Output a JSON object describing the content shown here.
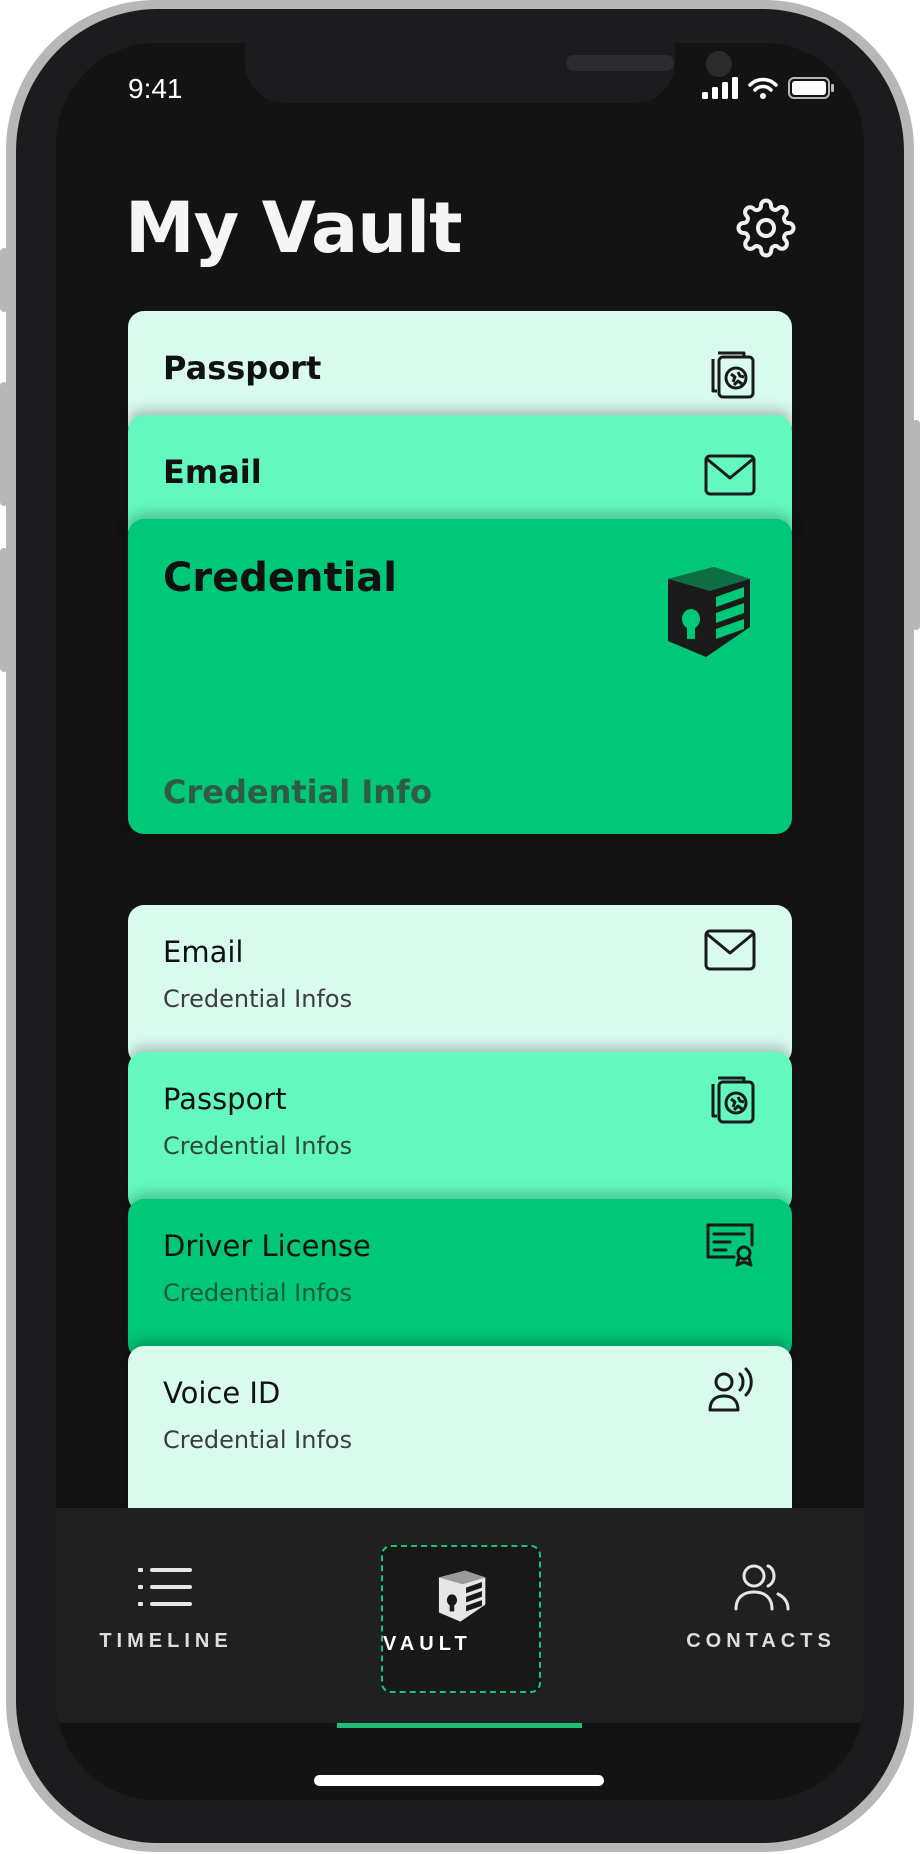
{
  "status_bar": {
    "time": "9:41"
  },
  "header": {
    "title": "My Vault"
  },
  "stack_top": {
    "cards": [
      {
        "title": "Passport",
        "icon": "passport-icon",
        "color": "#d9fbee"
      },
      {
        "title": "Email",
        "icon": "mail-icon",
        "color": "#63f8be"
      },
      {
        "title": "Credential",
        "subtitle": "Credential Info",
        "icon": "vault-box-icon",
        "color": "#00c878"
      }
    ]
  },
  "stack_list": {
    "cards": [
      {
        "title": "Email",
        "subtitle": "Credential Infos",
        "icon": "mail-icon",
        "color": "#d9fbee"
      },
      {
        "title": "Passport",
        "subtitle": "Credential Infos",
        "icon": "passport-icon",
        "color": "#63f8be"
      },
      {
        "title": "Driver License",
        "subtitle": "Credential Infos",
        "icon": "license-icon",
        "color": "#00c878"
      },
      {
        "title": "Voice ID",
        "subtitle": "Credential Infos",
        "icon": "voice-id-icon",
        "color": "#d9fbee"
      }
    ]
  },
  "nav": {
    "items": [
      {
        "label": "TIMELINE",
        "icon": "list-icon"
      },
      {
        "label": "VAULT",
        "icon": "vault-box-icon",
        "active": true
      },
      {
        "label": "CONTACTS",
        "icon": "contacts-icon"
      }
    ]
  },
  "colors": {
    "accent": "#00c878",
    "background": "#131313",
    "nav_bg": "#202020"
  }
}
